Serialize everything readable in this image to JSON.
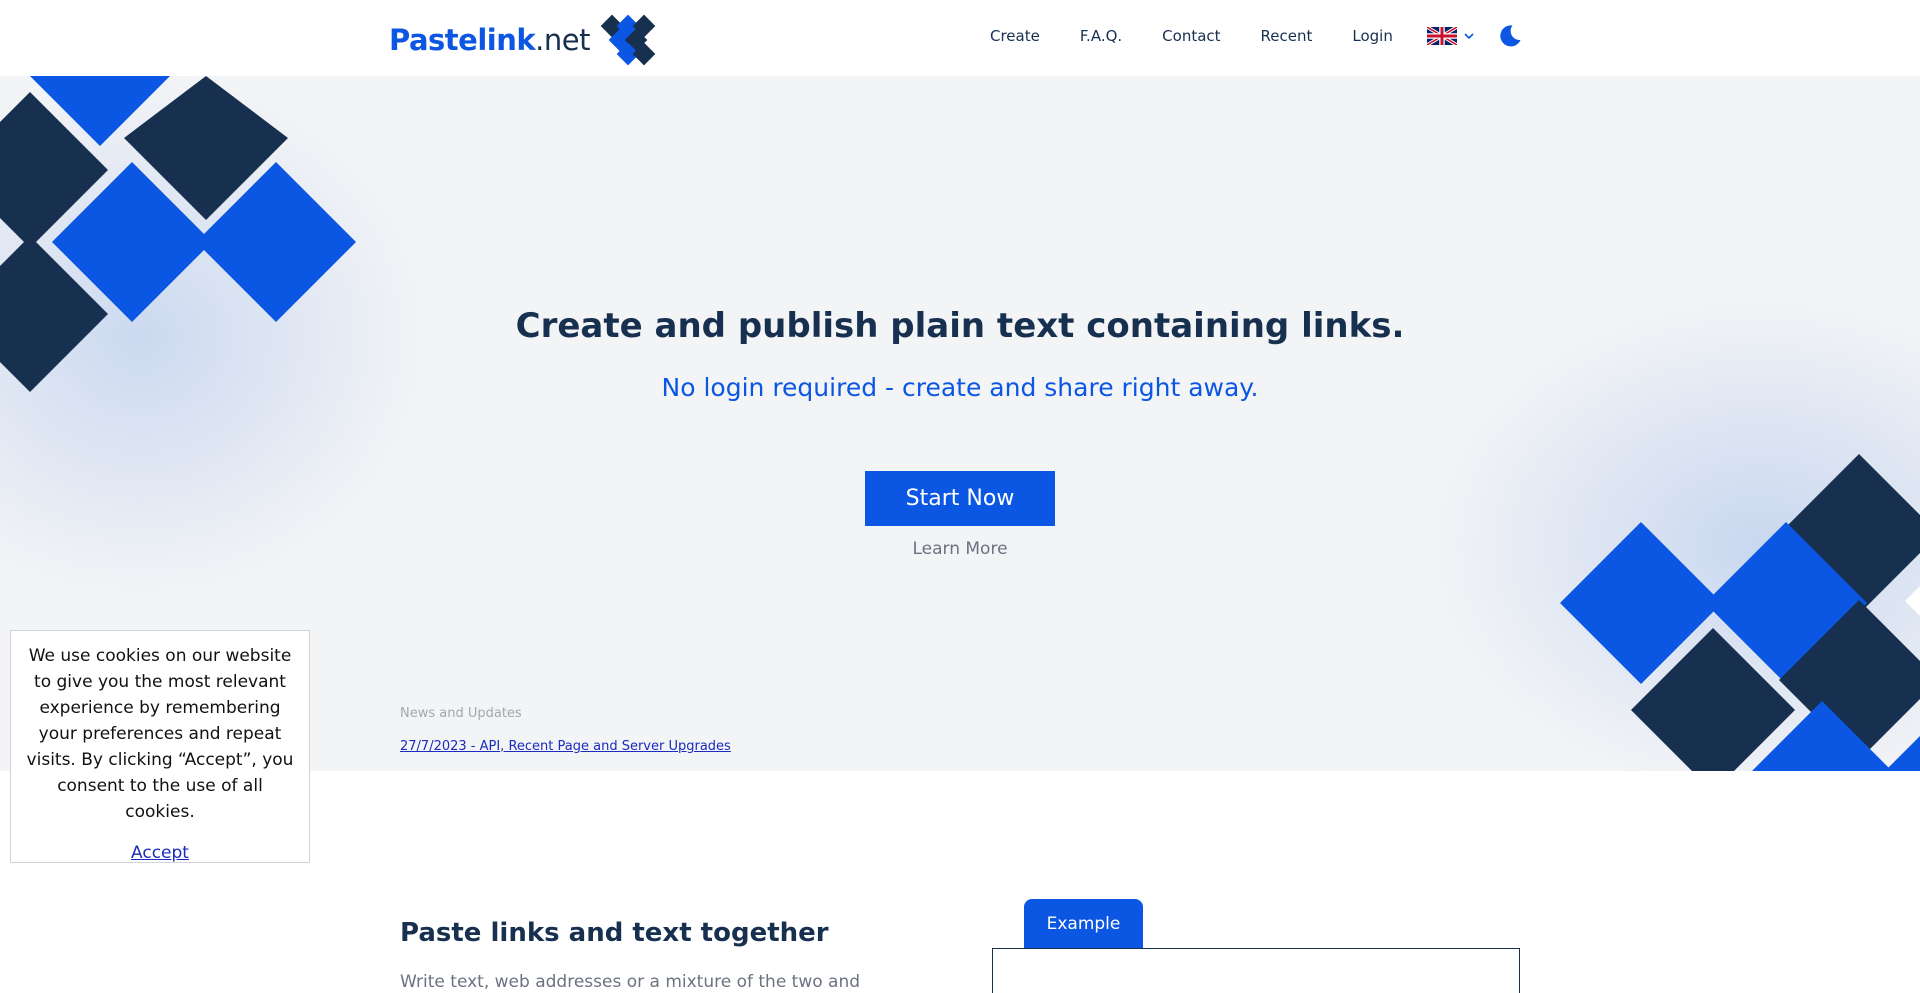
{
  "brand": {
    "name_strong": "Pastelink",
    "name_light": ".net"
  },
  "nav": {
    "items": [
      {
        "label": "Create"
      },
      {
        "label": "F.A.Q."
      },
      {
        "label": "Contact"
      },
      {
        "label": "Recent"
      },
      {
        "label": "Login"
      }
    ],
    "language_icon": "uk-flag-icon",
    "theme_icon": "moon-icon"
  },
  "hero": {
    "title": "Create and publish plain text containing links.",
    "subtitle": "No login required - create and share right away.",
    "start_label": "Start Now",
    "learn_more_label": "Learn More",
    "news_label": "News and Updates",
    "news_link": "27/7/2023 - API, Recent Page and Server Upgrades"
  },
  "feature": {
    "title": "Paste links and text together",
    "text": "Write text, web addresses or a mixture of the two and",
    "example_tab": "Example"
  },
  "cookie": {
    "text": "We use cookies on our website to give you the most relevant experience by remembering your preferences and repeat visits. By clicking “Accept”, you consent to the use of all cookies.",
    "accept_label": "Accept"
  },
  "colors": {
    "brand_blue": "#0b57e3",
    "navy": "#17304f",
    "hero_bg": "#f3f4f6",
    "link_blue": "#1a2bbd"
  }
}
